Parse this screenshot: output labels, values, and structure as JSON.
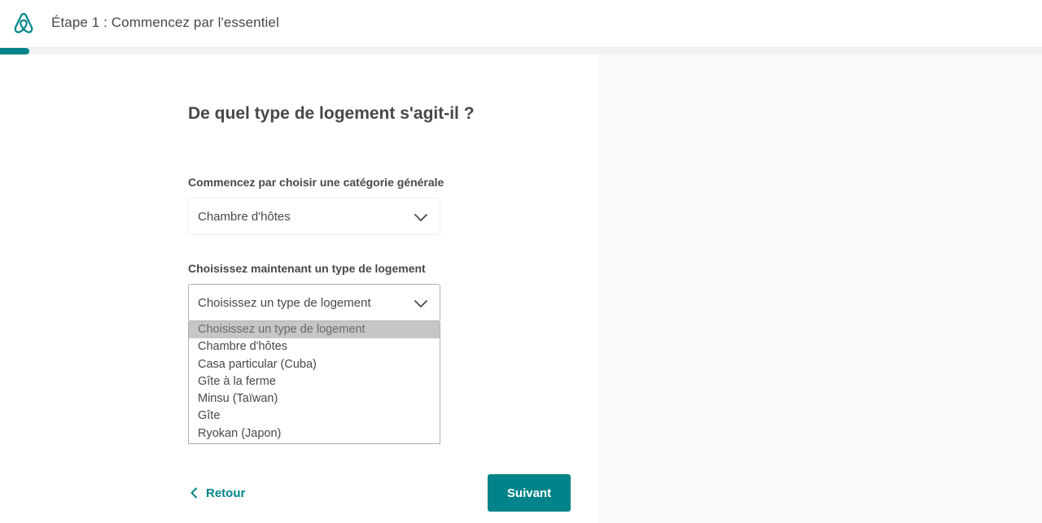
{
  "header": {
    "step_title": "Étape 1 : Commencez par l'essentiel",
    "logo_icon": "airbnb-logo-icon"
  },
  "progress": {
    "fraction": 0.028,
    "color": "#008489"
  },
  "main": {
    "question": "De quel type de logement s'agit-il ?",
    "category_label": "Commencez par choisir une catégorie générale",
    "category_value": "Chambre d'hôtes",
    "type_label": "Choisissez maintenant un type de logement",
    "type_value": "Choisissez un type de logement",
    "type_options": [
      "Choisissez un type de logement",
      "Chambre d'hôtes",
      "Casa particular (Cuba)",
      "Gîte à la ferme",
      "Minsu (Taïwan)",
      "Gîte",
      "Ryokan (Japon)"
    ],
    "highlighted_option": 0
  },
  "footer": {
    "back_label": "Retour",
    "next_label": "Suivant",
    "back_icon": "chevron-left-icon"
  },
  "colors": {
    "accent": "#008489",
    "text": "#484848"
  }
}
